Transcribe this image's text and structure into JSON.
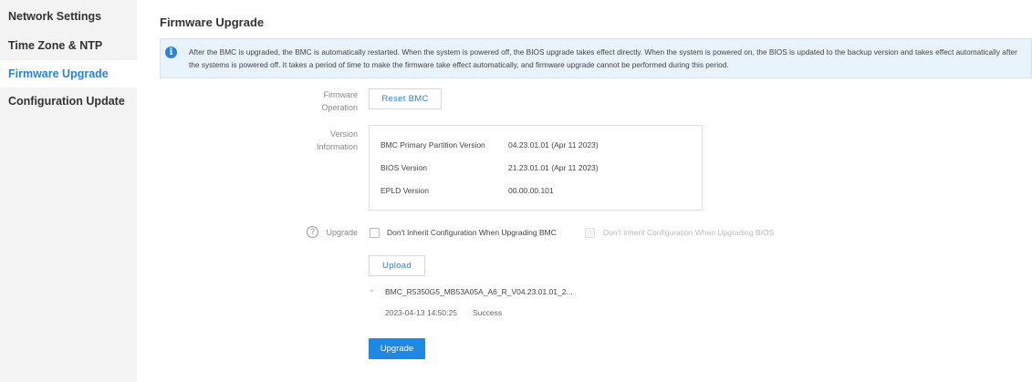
{
  "sidebar": {
    "items": [
      {
        "label": "Network Settings"
      },
      {
        "label": "Time Zone & NTP"
      },
      {
        "label": "Firmware Upgrade"
      },
      {
        "label": "Configuration Update"
      }
    ]
  },
  "main": {
    "title": "Firmware Upgrade",
    "info_text": "After the BMC is upgraded, the BMC is automatically restarted. When the system is powered off, the BIOS upgrade takes effect directly. When the system is powered on, the BIOS is updated to the backup version and takes effect automatically after the systems is powered off. It takes a period of time to make the firmware take effect automatically, and firmware upgrade cannot be performed during this period.",
    "firmware_operation": {
      "label_line1": "Firmware",
      "label_line2": "Operation",
      "reset_button": "Reset BMC"
    },
    "version_info": {
      "label_line1": "Version",
      "label_line2": "Information",
      "rows": [
        {
          "name": "BMC Primary Partition Version",
          "value": "04.23.01.01  (Apr 11 2023)"
        },
        {
          "name": "BIOS Version",
          "value": "21.23.01.01  (Apr 11 2023)"
        },
        {
          "name": "EPLD Version",
          "value": "00.00.00.101"
        }
      ]
    },
    "upgrade": {
      "label": "Upgrade",
      "help_symbol": "?",
      "option_bmc": "Don't Inherit Configuration When Upgrading BMC",
      "option_bios": "Don't Inherit Configuration When Upgrading BIOS",
      "upload_button": "Upload",
      "file_name": "BMC_R5350G5_MB53A05A_A6_R_V04.23.01.01_2...",
      "file_timestamp": "2023-04-13 14:50:25",
      "file_status": "Success",
      "upgrade_button": "Upgrade"
    }
  },
  "colors": {
    "accent": "#2a83d6",
    "primary_button": "#1e88e5",
    "info_bg": "#e9f3fb",
    "sidebar_bg": "#f3f3f3"
  }
}
